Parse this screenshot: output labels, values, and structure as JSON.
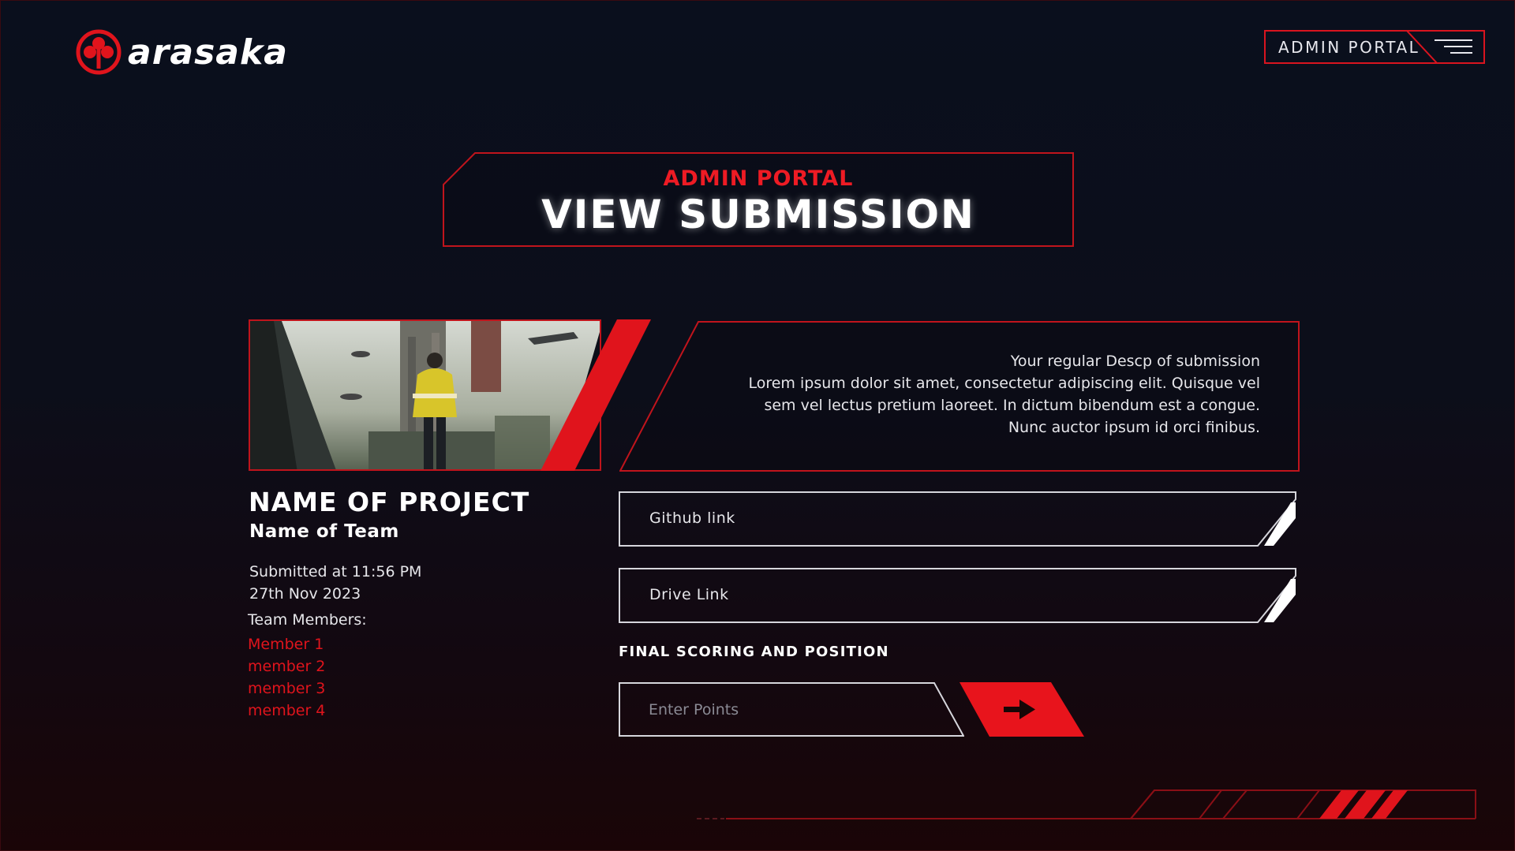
{
  "brand": {
    "name": "arasaka",
    "accent": "#e0141c"
  },
  "header": {
    "admin_button_label": "ADMIN PORTAL",
    "menu_icon": "hamburger-menu-icon"
  },
  "title": {
    "kicker": "ADMIN PORTAL",
    "main": "VIEW SUBMISSION"
  },
  "submission": {
    "description_lines": [
      "Your regular Descp of submission",
      "Lorem ipsum dolor sit amet, consectetur adipiscing elit. Quisque vel",
      "sem vel lectus pretium laoreet. In dictum bibendum est a congue.",
      "Nunc auctor ipsum id orci finibus."
    ],
    "project_name": "NAME OF PROJECT",
    "team_name": "Name of Team",
    "submitted_line1": "Submitted at 11:56 PM",
    "submitted_line2": "27th Nov 2023",
    "members_title": "Team Members:",
    "members": [
      "Member 1",
      "member 2",
      "member 3",
      "member 4"
    ],
    "github_label": "Github link",
    "drive_label": "Drive Link"
  },
  "scoring": {
    "title": "FINAL SCORING AND POSITION",
    "points_placeholder": "Enter Points",
    "submit_icon": "arrow-right-icon"
  }
}
